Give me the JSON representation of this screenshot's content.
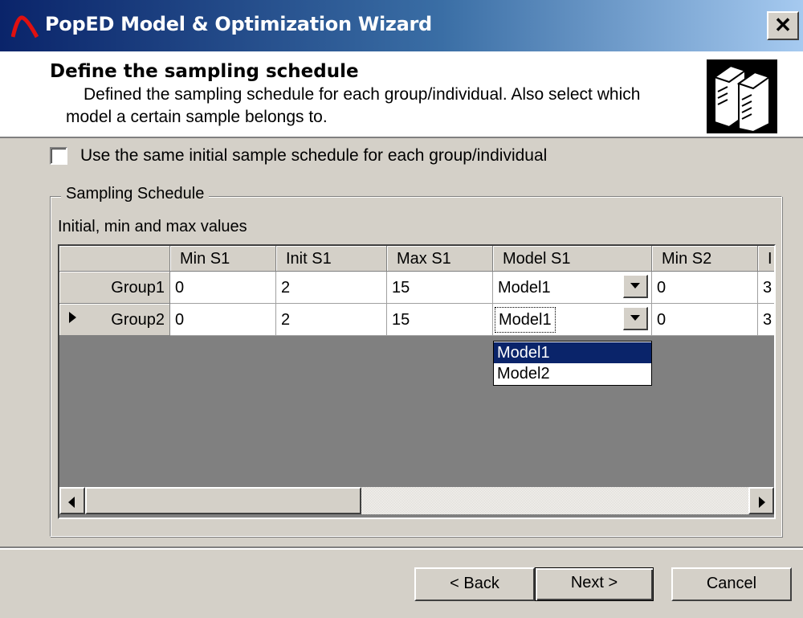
{
  "window": {
    "title": "PopED Model & Optimization Wizard",
    "close_glyph": "✕"
  },
  "header": {
    "title": "Define the sampling schedule",
    "description_line1": "Defined the sampling schedule for each group/individual. Also select which",
    "description_line2": "model a certain sample belongs to.",
    "graphic_icon": "computer-towers-icon"
  },
  "options": {
    "same_schedule_label": "Use the same initial sample schedule for each group/individual",
    "same_schedule_checked": false
  },
  "sampling_group": {
    "legend": "Sampling Schedule",
    "caption": "Initial, min and max values",
    "columns": [
      "Min S1",
      "Init S1",
      "Max S1",
      "Model S1",
      "Min S2",
      "I"
    ],
    "rows": [
      {
        "label": "Group1",
        "values": [
          "0",
          "2",
          "15",
          "Model1",
          "0",
          "3"
        ]
      },
      {
        "label": "Group2",
        "values": [
          "0",
          "2",
          "15",
          "Model1",
          "0",
          "3"
        ],
        "current": true
      }
    ],
    "dropdown_options": [
      "Model1",
      "Model2"
    ],
    "dropdown_selected": "Model1"
  },
  "buttons": {
    "back": "< Back",
    "next": "Next >",
    "cancel": "Cancel"
  },
  "colors": {
    "title_bar": "#0a246a",
    "selection": "#0a246a",
    "dialog_bg": "#d4d0c8"
  }
}
